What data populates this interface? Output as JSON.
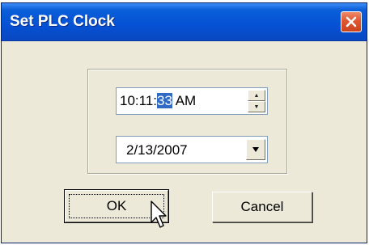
{
  "window": {
    "title": "Set PLC Clock"
  },
  "time": {
    "hm": "10:11:",
    "seconds": "33",
    "ampm": " AM"
  },
  "date": {
    "value": "2/13/2007"
  },
  "buttons": {
    "ok_label": "OK",
    "cancel_label": "Cancel"
  },
  "icons": {
    "close": "close-x-icon",
    "spin_up": "spin-up-arrow-icon",
    "spin_down": "spin-down-arrow-icon",
    "dropdown": "chevron-down-icon",
    "cursor": "mouse-pointer-icon"
  },
  "colors": {
    "titlebar": "#0551d4",
    "dialog_bg": "#ece9d8",
    "close_button": "#e0562f",
    "selection": "#316ac5"
  }
}
